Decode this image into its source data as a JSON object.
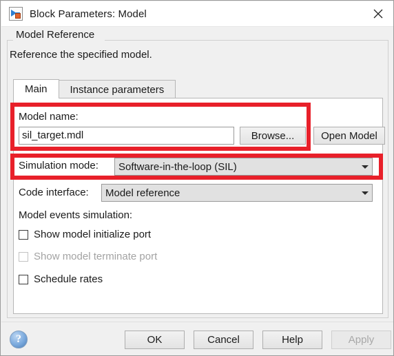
{
  "window": {
    "title": "Block Parameters: Model",
    "icon": "simulink-model-block-icon",
    "close_label": "✕"
  },
  "group": {
    "title": "Model Reference",
    "description": "Reference the specified model."
  },
  "tabs": [
    {
      "label": "Main",
      "active": true
    },
    {
      "label": "Instance parameters",
      "active": false
    }
  ],
  "form": {
    "model_name_label": "Model name:",
    "model_name_value": "sil_target.mdl",
    "browse_label": "Browse...",
    "open_model_label": "Open Model",
    "simulation_mode_label": "Simulation mode:",
    "simulation_mode_value": "Software-in-the-loop (SIL)",
    "code_interface_label": "Code interface:",
    "code_interface_value": "Model reference",
    "model_events_label": "Model events simulation:",
    "checkboxes": [
      {
        "label": "Show model initialize port",
        "checked": false,
        "enabled": true
      },
      {
        "label": "Show model terminate port",
        "checked": false,
        "enabled": false
      },
      {
        "label": "Schedule rates",
        "checked": false,
        "enabled": true
      }
    ]
  },
  "footer": {
    "help_icon": "question-mark-icon",
    "buttons": [
      {
        "label": "OK",
        "enabled": true
      },
      {
        "label": "Cancel",
        "enabled": true
      },
      {
        "label": "Help",
        "enabled": true
      },
      {
        "label": "Apply",
        "enabled": false
      }
    ]
  },
  "annotations": {
    "highlight_color": "#e8202a",
    "boxes": [
      {
        "name": "model-name-highlight"
      },
      {
        "name": "simulation-mode-highlight"
      }
    ]
  }
}
